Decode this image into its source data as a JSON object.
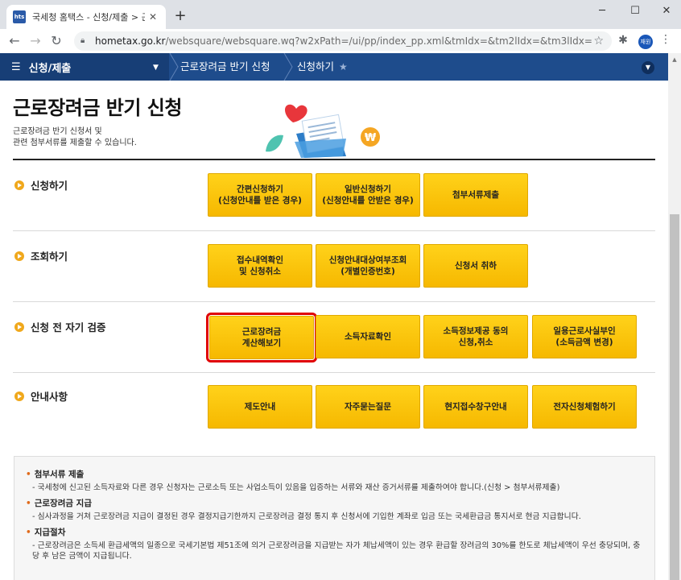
{
  "browser": {
    "tab_title": "국세청 홈택스 - 신청/제출 > 근",
    "favicon_text": "hts",
    "url_host": "hometax.go.kr",
    "url_path": "/websquare/websquare.wq?w2xPath=/ui/pp/index_pp.xml&tmIdx=&tm2lIdx=&tm3lIdx=",
    "profile_label": "재원"
  },
  "nav": {
    "menu_label": "신청/제출",
    "breadcrumbs": [
      "근로장려금 반기 신청",
      "신청하기"
    ]
  },
  "page": {
    "title": "근로장려금 반기 신청",
    "desc_line1": "근로장려금 반기 신청서 및",
    "desc_line2": "관련 첨부서류를 제출할 수 있습니다."
  },
  "sections": [
    {
      "title": "신청하기",
      "buttons": [
        "간편신청하기\n(신청안내를 받은 경우)",
        "일반신청하기\n(신청안내를 안받은 경우)",
        "첨부서류제출"
      ]
    },
    {
      "title": "조회하기",
      "buttons": [
        "접수내역확인\n및 신청취소",
        "신청안내대상여부조회\n(개별인증번호)",
        "신청서 취하"
      ]
    },
    {
      "title": "신청 전 자기 검증",
      "buttons": [
        "근로장려금\n계산해보기",
        "소득자료확인",
        "소득정보제공 동의\n신청,취소",
        "일용근로사실부인\n(소득금액 변경)"
      ]
    },
    {
      "title": "안내사항",
      "buttons": [
        "제도안내",
        "자주묻는질문",
        "현지접수창구안내",
        "전자신청체험하기"
      ]
    }
  ],
  "selected_button": "근로장려금\n계산해보기",
  "notice": [
    {
      "head": "첨부서류 제출",
      "text": "- 국세청에 신고된 소득자료와 다른 경우 신청자는 근로소득 또는 사업소득이 있음을 입증하는 서류와 재산 증거서류를 제출하여야 합니다.(신청 > 첨부서류제출)"
    },
    {
      "head": "근로장려금 지급",
      "text": "- 심사과정을 거쳐 근로장려금 지급이 결정된 경우 결정지급기한까지 근로장려금 결정 통지 후 신청서에 기입한 계좌로 입금 또는 국세환급금 통지서로 현금 지급합니다."
    },
    {
      "head": "지급절차",
      "text": "- 근로장려금은 소득세 환급세액의 일종으로 국세기본법 제51조에 의거 근로장려금을 지급받는 자가 체납세액이 있는 경우 환급할 장려금의 30%를 한도로 체납세액이 우선 충당되며, 충당 후 남은 금액이 지급됩니다."
    }
  ],
  "colors": {
    "nav": "#1e4c8c",
    "button": "#ffc800",
    "accent": "#e00000",
    "bullet": "#f0a81c"
  }
}
